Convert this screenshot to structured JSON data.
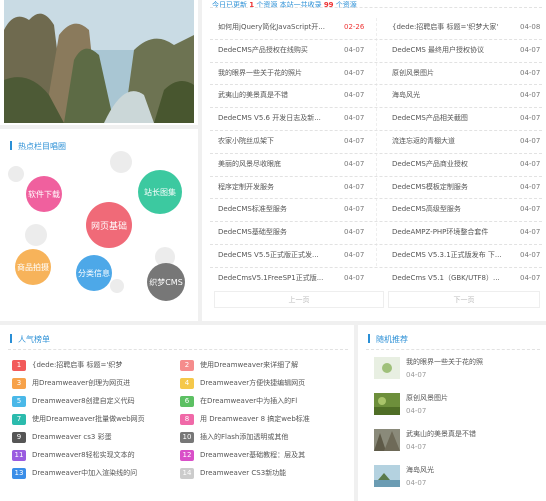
{
  "notice": {
    "prefix": "今日已更新",
    "today_count": "1",
    "mid": "个资源 本站一共收录",
    "total_count": "99",
    "suffix": "个资源"
  },
  "hot_columns": {
    "title": "热点栏目唱圈",
    "tags": [
      {
        "label": "软件下载",
        "color": "#f0609e"
      },
      {
        "label": "站长图集",
        "color": "#3cc9a0"
      },
      {
        "label": "网页基础",
        "color": "#f06a78"
      },
      {
        "label": "商品拍摄",
        "color": "#f7b35a"
      },
      {
        "label": "分类信息",
        "color": "#4da8e8"
      },
      {
        "label": "织梦CMS",
        "color": "#777777"
      }
    ]
  },
  "news": {
    "left": [
      {
        "title": "如何用jQuery简化JavaScript开...",
        "date": "02-26",
        "hot": true
      },
      {
        "title": "DedeCMS产品授权在线购买",
        "date": "04-07"
      },
      {
        "title": "我的眼界一些关于花的照片",
        "date": "04-07"
      },
      {
        "title": "武夷山的美景真是不错",
        "date": "04-07"
      },
      {
        "title": "DedeCMS V5.6 开发日志及新...",
        "date": "04-07"
      },
      {
        "title": "农家小院丝瓜架下",
        "date": "04-07"
      },
      {
        "title": "美丽的风景尽收眼底",
        "date": "04-07"
      },
      {
        "title": "程序定制开发服务",
        "date": "04-07"
      },
      {
        "title": "DedeCMS标准型服务",
        "date": "04-07"
      },
      {
        "title": "DedeCMS基础型服务",
        "date": "04-07"
      },
      {
        "title": "DedeCMS V5.5正式版正式发...",
        "date": "04-07"
      },
      {
        "title": "DedeCmsV5.1FreeSP1正式版...",
        "date": "04-07"
      }
    ],
    "right": [
      {
        "title": "{dede:招聘启事 标题='织梦大家'",
        "date": "04-08"
      },
      {
        "title": "DedeCMS 最终用户授权协议",
        "date": "04-07"
      },
      {
        "title": "原创风景图片",
        "date": "04-07"
      },
      {
        "title": "海岛风光",
        "date": "04-07"
      },
      {
        "title": "DedeCMS产品相关截图",
        "date": "04-07"
      },
      {
        "title": "流连忘返的青棚大道",
        "date": "04-07"
      },
      {
        "title": "DedeCMS产品商业授权",
        "date": "04-07"
      },
      {
        "title": "DedeCMS模板定制服务",
        "date": "04-07"
      },
      {
        "title": "DedeCMS高级型服务",
        "date": "04-07"
      },
      {
        "title": "DedeAMPZ-PHP环境整合套件",
        "date": "04-07"
      },
      {
        "title": "DedeCMS V5.3.1正式版发布 下...",
        "date": "04-07"
      },
      {
        "title": "DedeCms V5.1（GBK/UTF8）...",
        "date": "04-07"
      }
    ],
    "prev_page": "上一页",
    "next_page": "下一页"
  },
  "ranking": {
    "title": "人气榜单",
    "items": [
      {
        "num": "1",
        "label": "{dede:招聘启事 标题='织梦",
        "color": "#f25a5a"
      },
      {
        "num": "2",
        "label": "使用Dreamweaver来详细了解",
        "color": "#f58c8c"
      },
      {
        "num": "3",
        "label": "用Dreamweaver创理为网页进",
        "color": "#f7a24a"
      },
      {
        "num": "4",
        "label": "Dreamweaver方便快捷编辑网页",
        "color": "#f5c84a"
      },
      {
        "num": "5",
        "label": "Dreamweaver8创建自定义代码",
        "color": "#4ab8e8"
      },
      {
        "num": "6",
        "label": "在Dreamweaver中为插入的Fl",
        "color": "#5cc063"
      },
      {
        "num": "7",
        "label": "使用Dreamweaver批量做web网页",
        "color": "#2bbbad"
      },
      {
        "num": "8",
        "label": "用 Dreamweaver 8 搞定web标准",
        "color": "#f069a8"
      },
      {
        "num": "9",
        "label": "Dreamweaver cs3 彩蛋",
        "color": "#555555"
      },
      {
        "num": "10",
        "label": "插入的Flash添加透明或其他",
        "color": "#777777"
      },
      {
        "num": "11",
        "label": "Dreamweaver8轻松实现文本的",
        "color": "#9a5ce0"
      },
      {
        "num": "12",
        "label": "Dreamweaver基础教程：层及其",
        "color": "#d94fc8"
      },
      {
        "num": "13",
        "label": "Dreamweaver中加入渲染线的问",
        "color": "#3a8ee8"
      },
      {
        "num": "14",
        "label": "Dreamweaver CS3新功能",
        "color": "#cccccc"
      }
    ]
  },
  "random": {
    "title": "随机推荐",
    "items": [
      {
        "title": "我的眼界一些关于花的照",
        "date": "04-07"
      },
      {
        "title": "原创风景图片",
        "date": "04-07"
      },
      {
        "title": "武夷山的美景真是不错",
        "date": "04-07"
      },
      {
        "title": "海岛风光",
        "date": "04-07"
      }
    ]
  }
}
